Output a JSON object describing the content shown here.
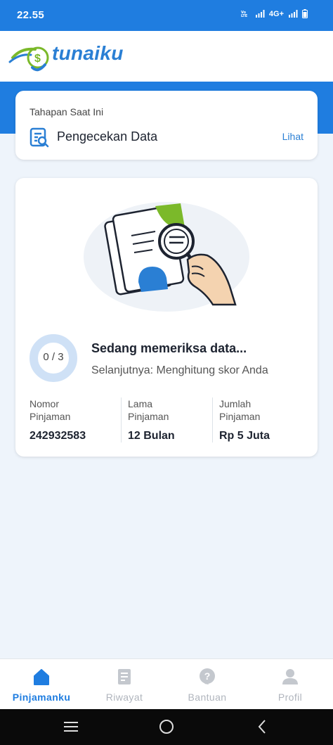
{
  "status_bar": {
    "time": "22.55",
    "network": "4G+"
  },
  "header": {
    "logo_text": "tunaiku"
  },
  "stage_card": {
    "caption": "Tahapan Saat Ini",
    "title": "Pengecekan Data",
    "link_label": "Lihat"
  },
  "check_card": {
    "progress": "0 / 3",
    "progress_fraction": 0,
    "title": "Sedang memeriksa data...",
    "subtitle": "Selanjutnya: Menghitung skor Anda",
    "info": [
      {
        "label": "Nomor Pinjaman",
        "value": "242932583"
      },
      {
        "label": "Lama Pinjaman",
        "value": "12 Bulan"
      },
      {
        "label": "Jumlah Pinjaman",
        "value": "Rp 5 Juta"
      }
    ]
  },
  "bottom_nav": {
    "items": [
      {
        "label": "Pinjamanku",
        "icon": "home-icon",
        "active": true
      },
      {
        "label": "Riwayat",
        "icon": "document-icon",
        "active": false
      },
      {
        "label": "Bantuan",
        "icon": "help-icon",
        "active": false
      },
      {
        "label": "Profil",
        "icon": "profile-icon",
        "active": false
      }
    ]
  },
  "colors": {
    "primary": "#1f7de0",
    "accent_green": "#7bb92a",
    "inactive": "#b0b5bd"
  }
}
